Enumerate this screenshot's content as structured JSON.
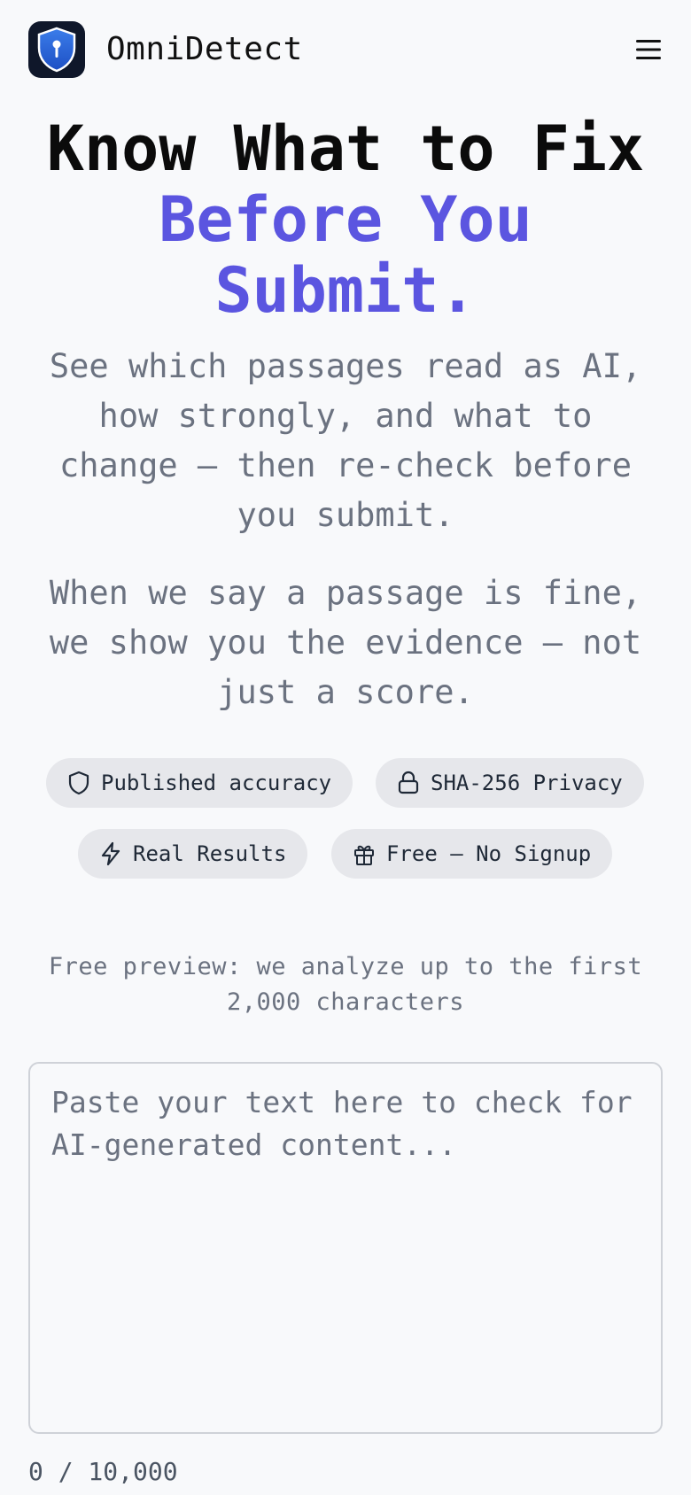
{
  "header": {
    "brand": "OmniDetect",
    "logo_icon": "shield-lock-icon",
    "menu_icon": "hamburger-menu-icon"
  },
  "hero": {
    "title_line1": "Know What to Fix",
    "title_line2": "Before You",
    "title_line3": "Submit.",
    "subtitle": "See which passages read as AI, how strongly, and what to change — then re-check before you submit.",
    "evidence_text": "When we say a passage is fine, we show you the evidence — not just a score."
  },
  "badges": [
    {
      "label": "Published accuracy",
      "icon": "shield-icon"
    },
    {
      "label": "SHA-256 Privacy",
      "icon": "lock-icon"
    },
    {
      "label": "Real Results",
      "icon": "lightning-icon"
    },
    {
      "label": "Free — No Signup",
      "icon": "gift-icon"
    }
  ],
  "input": {
    "note": "Free preview: we analyze up to the first 2,000 characters",
    "value": "",
    "placeholder": "Paste your text here to check for AI-generated content...",
    "char_count": "0 / 10,000"
  },
  "colors": {
    "accent": "#5b55e0",
    "background": "#f8f9fb",
    "badge_bg": "#e6e7eb",
    "muted_text": "#6b7280"
  }
}
